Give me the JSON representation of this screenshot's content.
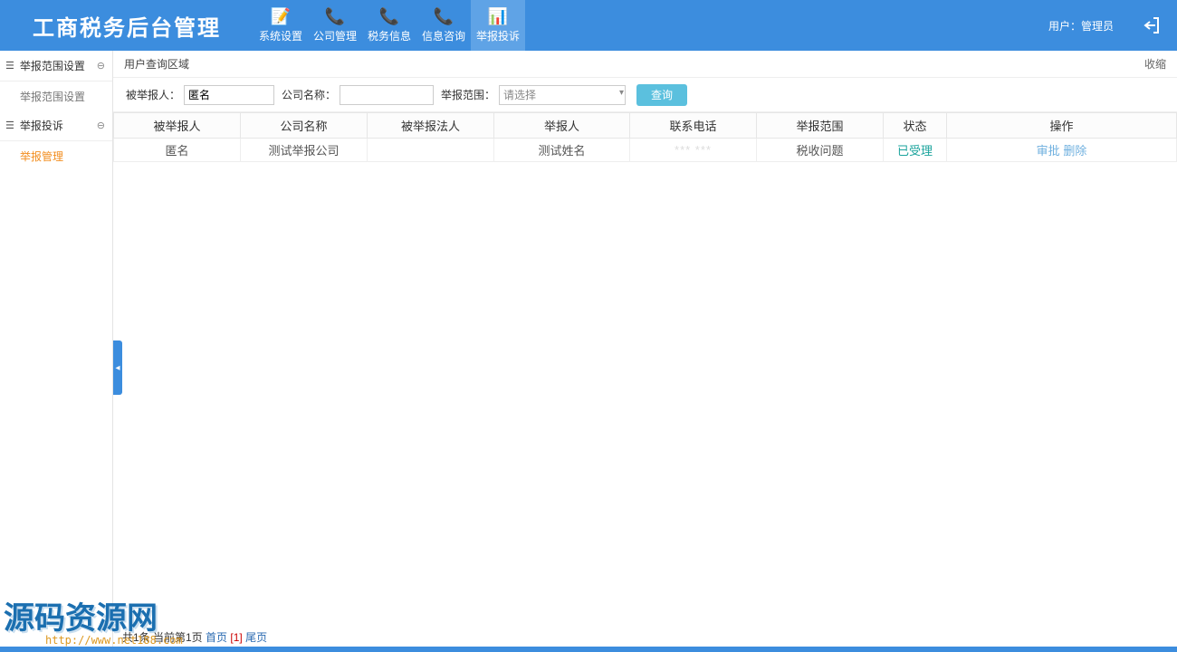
{
  "header": {
    "logo": "工商税务后台管理",
    "nav": [
      {
        "icon": "📝",
        "label": "系统设置"
      },
      {
        "icon": "📞",
        "label": "公司管理"
      },
      {
        "icon": "📞",
        "label": "税务信息"
      },
      {
        "icon": "📞",
        "label": "信息咨询"
      },
      {
        "icon": "📊",
        "label": "举报投诉",
        "active": true
      }
    ],
    "user_prefix": "用户：",
    "user_name": "管理员"
  },
  "sidebar": {
    "groups": [
      {
        "label": "举报范围设置",
        "children": [
          {
            "label": "举报范围设置",
            "active": false
          }
        ]
      },
      {
        "label": "举报投诉",
        "children": [
          {
            "label": "举报管理",
            "active": true
          }
        ]
      }
    ]
  },
  "panel": {
    "title": "用户查询区域",
    "collapse": "收缩"
  },
  "search": {
    "l1": "被举报人：",
    "v1": "匿名",
    "l2": "公司名称：",
    "v2": "",
    "l3": "举报范围：",
    "sel_placeholder": "请选择",
    "query": "查询"
  },
  "table": {
    "headers": [
      "被举报人",
      "公司名称",
      "被举报法人",
      "举报人",
      "联系电话",
      "举报范围",
      "状态",
      "操作"
    ],
    "row": {
      "reported": "匿名",
      "company": "测试举报公司",
      "legal": "",
      "reporter": "测试姓名",
      "phone": "*** ***",
      "scope": "税收问题",
      "status": "已受理",
      "op_approve": "审批",
      "op_delete": "删除"
    }
  },
  "pager": {
    "text": "共1条 当前第1页",
    "first": "首页",
    "cur": "[1]",
    "last": "尾页"
  },
  "watermark": {
    "line1": "源码资源网",
    "line2": "http://www.net188.com"
  }
}
